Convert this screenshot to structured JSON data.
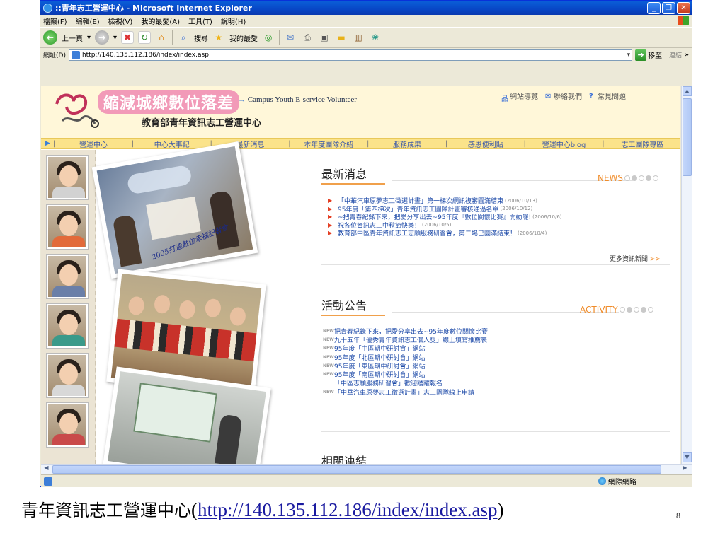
{
  "window": {
    "title": "::青年志工營運中心 - Microsoft Internet Explorer",
    "menu": [
      "檔案(F)",
      "編輯(E)",
      "檢視(V)",
      "我的最愛(A)",
      "工具(T)",
      "說明(H)"
    ],
    "toolbar": {
      "back": "上一頁",
      "search": "搜尋",
      "favorites": "我的最愛"
    },
    "address_label": "網址(D)",
    "address_value": "http://140.135.112.186/index/index.asp",
    "go_label": "移至",
    "links_label": "連結",
    "status_zone": "網際網路"
  },
  "site": {
    "title": "縮減城鄉數位落差",
    "subtitle": "教育部青年資訊志工營運中心",
    "english_title": "Campus Youth E-service Volunteer",
    "top_links": [
      "網站導覽",
      "聯絡我們",
      "常見問題"
    ],
    "nav": [
      "營運中心",
      "中心大事記",
      "最新消息",
      "本年度團隊介紹",
      "服務成果",
      "感恩便利貼",
      "營運中心blog",
      "志工團隊專區"
    ],
    "collage_caption": "2005打造數位幸福記者會"
  },
  "news": {
    "title": "最新消息",
    "badge": "NEWS",
    "more": "更多資訊新聞",
    "items": [
      {
        "text": "「中華汽車原夢志工徵選計畫」第一梯次網訊複審圓滿結束",
        "date": "(2006/10/13)"
      },
      {
        "text": "95年度「第四梯次」青年資訊志工團隊計畫審核通過名單",
        "date": "(2006/10/12)"
      },
      {
        "text": "~把青春紀錄下來，把愛分享出去~95年度『數位關懷比賽』開動囉!",
        "date": "(2006/10/6)"
      },
      {
        "text": "祝各位資訊志工中秋節快樂！",
        "date": "(2006/10/5)"
      },
      {
        "text": "教育部中區青年資訊志工志願服務研習會，第二場已圓滿結束！",
        "date": "(2006/10/4)"
      }
    ]
  },
  "activity": {
    "title": "活動公告",
    "badge": "ACTIVITY",
    "new_tag": "NEW",
    "items": [
      {
        "text": "把青春紀錄下來，把愛分享出去~95年度數位關懷比賽",
        "is_new": true
      },
      {
        "text": "九十五年「優秀青年資訊志工個人獎」線上填寫推薦表",
        "is_new": true
      },
      {
        "text": "95年度「中區期中研討會」網站",
        "is_new": true
      },
      {
        "text": "95年度「北區期中研討會」網站",
        "is_new": true
      },
      {
        "text": "95年度「東區期中研討會」網站",
        "is_new": true
      },
      {
        "text": "95年度「南區期中研討會」網站",
        "is_new": true
      },
      {
        "text": "「中區志願服務研習會」歡迎踴躍報名",
        "is_new": false
      },
      {
        "text": "「中華汽車原夢志工徵選計畫」志工團隊線上申請",
        "is_new": true
      }
    ]
  },
  "links_section": {
    "title": "相關連結"
  },
  "slide": {
    "caption_prefix": "青年資訊志工營運中心",
    "caption_url": "http://140.135.112.186/index/index.asp",
    "page_number": "8"
  },
  "colors": {
    "accent_orange": "#f08c2a",
    "nav_bar": "#fbe38a",
    "link_blue": "#1d4aa8",
    "header_bg": "#fff7d9",
    "title_pink": "#f29ab8"
  }
}
